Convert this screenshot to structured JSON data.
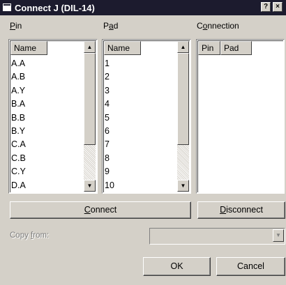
{
  "window": {
    "title": "Connect J (DIL-14)",
    "help_glyph": "?",
    "close_glyph": "×"
  },
  "pin": {
    "label_mnemonic": "P",
    "label_rest": "in",
    "column": "Name",
    "items": [
      "A.A",
      "A.B",
      "A.Y",
      "B.A",
      "B.B",
      "B.Y",
      "C.A",
      "C.B",
      "C.Y",
      "D.A"
    ]
  },
  "pad": {
    "label_pre": "P",
    "label_mnemonic": "a",
    "label_rest": "d",
    "column": "Name",
    "items": [
      "1",
      "2",
      "3",
      "4",
      "5",
      "6",
      "7",
      "8",
      "9",
      "10"
    ]
  },
  "connection": {
    "label_pre": "C",
    "label_mnemonic": "o",
    "label_rest": "nnection",
    "columns": [
      "Pin",
      "Pad"
    ]
  },
  "buttons": {
    "connect_mnemonic": "C",
    "connect_rest": "onnect",
    "disconnect_mnemonic": "D",
    "disconnect_rest": "isconnect",
    "ok": "OK",
    "cancel": "Cancel"
  },
  "copy_from": {
    "label_pre": "Copy ",
    "label_mnemonic": "f",
    "label_rest": "rom:",
    "value": ""
  },
  "icons": {
    "scroll_up": "▲",
    "scroll_down": "▼",
    "combo_down": "▼"
  },
  "colors": {
    "titlebar": "#1c1b2e",
    "face": "#d4d0c8",
    "disabled_text": "#808080"
  }
}
